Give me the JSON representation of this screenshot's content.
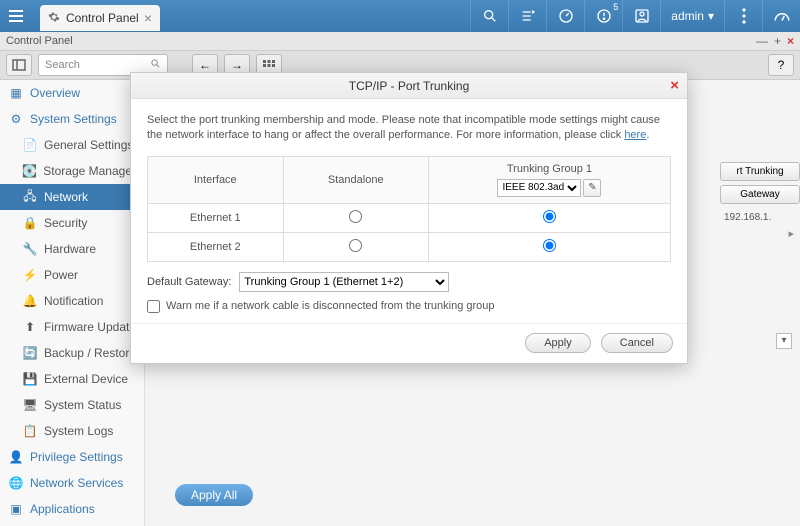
{
  "topbar": {
    "tab_label": "Control Panel",
    "user": "admin",
    "notif_count": "5"
  },
  "window": {
    "title": "Control Panel",
    "search_placeholder": "Search"
  },
  "sidebar": {
    "overview": "Overview",
    "system_settings": "System Settings",
    "items": [
      "General Settings",
      "Storage Manager",
      "Network",
      "Security",
      "Hardware",
      "Power",
      "Notification",
      "Firmware Update",
      "Backup / Restore",
      "External Device",
      "System Status",
      "System Logs"
    ],
    "privilege": "Privilege Settings",
    "network_services": "Network Services",
    "applications": "Applications"
  },
  "right_peek": {
    "btn1": "rt Trunking",
    "btn2": "Gateway",
    "ip": "192.168.1."
  },
  "modal": {
    "title": "TCP/IP - Port Trunking",
    "info": "Select the port trunking membership and mode. Please note that incompatible mode settings might cause the network interface to hang or affect the overall performance. For more information, please click ",
    "info_link": "here",
    "col_interface": "Interface",
    "col_standalone": "Standalone",
    "col_group": "Trunking Group 1",
    "group_mode": "IEEE 802.3ad",
    "row1": "Ethernet 1",
    "row2": "Ethernet 2",
    "gateway_label": "Default Gateway:",
    "gateway_value": "Trunking Group 1 (Ethernet 1+2)",
    "warn_label": "Warn me if a network cable is disconnected from the trunking group",
    "apply": "Apply",
    "cancel": "Cancel"
  },
  "content": {
    "apply_all": "Apply All"
  }
}
